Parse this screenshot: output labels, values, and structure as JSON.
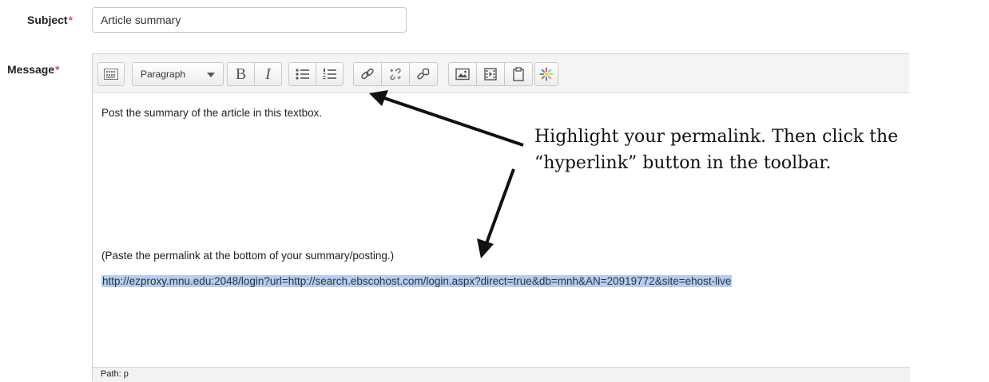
{
  "form": {
    "subject_label": "Subject",
    "subject_value": "Article summary",
    "message_label": "Message",
    "required_marker": "*"
  },
  "toolbar": {
    "format_value": "Paragraph",
    "bold_label": "B",
    "italic_label": "I",
    "icons": [
      "toolbar-toggle-icon",
      "chevron-down-icon",
      "bold-icon",
      "italic-icon",
      "bullet-list-icon",
      "numbered-list-icon",
      "link-icon",
      "unlink-icon",
      "autolink-icon",
      "image-icon",
      "media-icon",
      "paste-icon",
      "accessibility-icon"
    ]
  },
  "editor": {
    "line1": "Post the summary of the article in this textbox.",
    "line2": "(Paste the permalink at the bottom of your summary/posting.)",
    "permalink": "http://ezproxy.mnu.edu:2048/login?url=http://search.ebscohost.com/login.aspx?direct=true&db=mnh&AN=20919772&site=ehost-live",
    "path_label": "Path: p"
  },
  "annotation": {
    "text": "Highlight your permalink. Then click the\n“hyperlink” button in the toolbar."
  },
  "colors": {
    "required": "#d9534f",
    "selection": "#b4cdf3",
    "arrow": "#111111"
  }
}
